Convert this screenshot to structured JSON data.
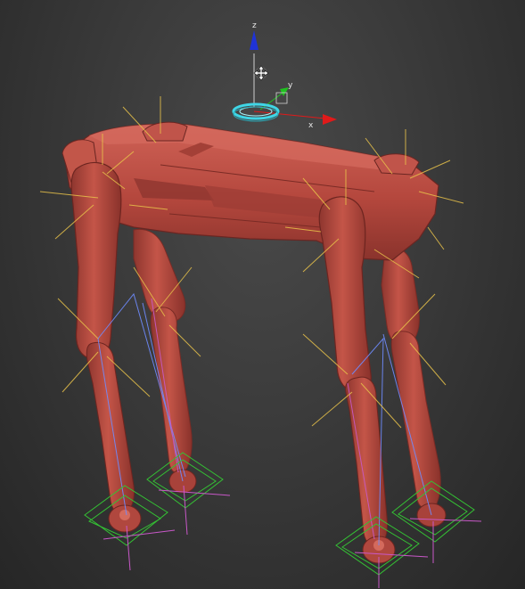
{
  "viewport": {
    "gizmo": {
      "axes": {
        "z": {
          "label": "z",
          "color": "#1f33d6"
        },
        "y": {
          "label": "y",
          "color": "#1fc21f"
        },
        "x": {
          "label": "x",
          "color": "#e01a1a"
        }
      },
      "move_cursor_icon": "move-cursor-icon"
    },
    "colors": {
      "robot_body": "#b84a40",
      "robot_shadow": "#7d2d27",
      "robot_highlight": "#d36a5e",
      "bone_lines": "#e8c24a",
      "ik_chain": "#6f8cff",
      "ik_chain_alt": "#c85ac8",
      "foot_controls": "#34c234",
      "ground_markers": "#c858c8",
      "root_control": "#3fd6e6"
    }
  }
}
